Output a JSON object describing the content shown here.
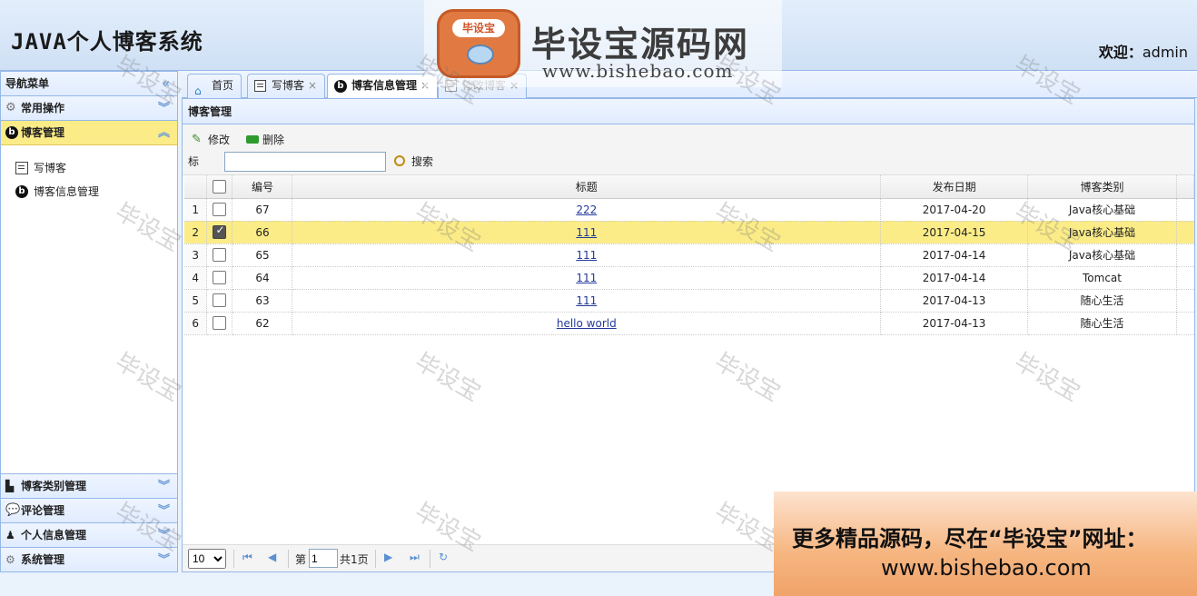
{
  "header": {
    "app_title": "JAVA个人博客系统",
    "welcome_label": "欢迎：",
    "username": "admin",
    "brand": {
      "name": "毕设宝源码网",
      "url": "www.bishebao.com",
      "logo_text": "毕设宝"
    }
  },
  "sidebar": {
    "title": "导航菜单",
    "sections": [
      {
        "label": "常用操作",
        "icon": "gear-icon",
        "expanded": false
      },
      {
        "label": "博客管理",
        "icon": "blog-icon",
        "expanded": true
      }
    ],
    "blog_items": [
      {
        "label": "写博客",
        "icon": "write-icon"
      },
      {
        "label": "博客信息管理",
        "icon": "blog-icon"
      }
    ],
    "lower_sections": [
      {
        "label": "博客类别管理",
        "icon": "category-icon"
      },
      {
        "label": "评论管理",
        "icon": "comment-icon"
      },
      {
        "label": "个人信息管理",
        "icon": "user-icon"
      },
      {
        "label": "系统管理",
        "icon": "settings-icon"
      }
    ]
  },
  "tabs": [
    {
      "label": "首页",
      "icon": "home-icon",
      "closable": false
    },
    {
      "label": "写博客",
      "icon": "write-icon",
      "closable": true
    },
    {
      "label": "博客信息管理",
      "icon": "blog-icon",
      "closable": true,
      "active": true
    },
    {
      "label": "修改博客",
      "icon": "write-icon",
      "closable": true
    }
  ],
  "panel": {
    "title": "博客管理",
    "edit_label": "修改",
    "delete_label": "删除",
    "search_label": "标题:",
    "search_value": "",
    "search_button": "搜索"
  },
  "grid": {
    "columns": [
      "编号",
      "标题",
      "发布日期",
      "博客类别"
    ],
    "rows": [
      {
        "n": "1",
        "id": "67",
        "title": "222",
        "date": "2017-04-20",
        "category": "Java核心基础",
        "checked": false
      },
      {
        "n": "2",
        "id": "66",
        "title": "111",
        "date": "2017-04-15",
        "category": "Java核心基础",
        "checked": true
      },
      {
        "n": "3",
        "id": "65",
        "title": "111",
        "date": "2017-04-14",
        "category": "Java核心基础",
        "checked": false
      },
      {
        "n": "4",
        "id": "64",
        "title": "111",
        "date": "2017-04-14",
        "category": "Tomcat",
        "checked": false
      },
      {
        "n": "5",
        "id": "63",
        "title": "111",
        "date": "2017-04-13",
        "category": "随心生活",
        "checked": false
      },
      {
        "n": "6",
        "id": "62",
        "title": "hello world",
        "date": "2017-04-13",
        "category": "随心生活",
        "checked": false
      }
    ]
  },
  "pager": {
    "page_size": "10",
    "page_prefix": "第",
    "page_value": "1",
    "page_total": "共1页"
  },
  "watermark_text": "毕设宝",
  "promo": {
    "line1": "更多精品源码，尽在“毕设宝”网址：",
    "line2": "www.bishebao.com"
  },
  "colors": {
    "border": "#95b8e7",
    "selected": "#fbec88",
    "header_bg": "#e0ecff"
  }
}
